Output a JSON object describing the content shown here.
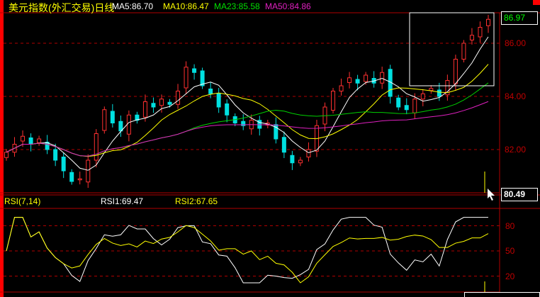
{
  "header": {
    "title": "美元指数(外汇交易)日线",
    "ma5": "MA5:86.70",
    "ma10": "MA10:86.47",
    "ma23": "MA23:85.58",
    "ma50": "MA50:84.86"
  },
  "price_axis": {
    "labels": [
      "86.00",
      "84.00",
      "82.00"
    ],
    "last_price": "86.97",
    "cursor_price": "80.49"
  },
  "rsi": {
    "title": "RSI(7,14)",
    "rsi1": "RSI1:69.47",
    "rsi2": "RSI2:67.65",
    "levels": [
      "80",
      "50",
      "20"
    ]
  },
  "colors": {
    "up": "#ff3030",
    "down": "#00e0e0",
    "ma5": "#ffffff",
    "ma10": "#ffff00",
    "ma23": "#00d000",
    "ma50": "#e020c0",
    "grid": "#b00000"
  },
  "chart_data": {
    "type": "candlestick",
    "closes": [
      81.9,
      82.2,
      82.5,
      82.2,
      82.4,
      82.0,
      81.6,
      81.2,
      80.8,
      80.9,
      81.6,
      82.6,
      83.5,
      83.0,
      82.7,
      83.3,
      83.1,
      83.8,
      83.6,
      83.9,
      83.7,
      84.2,
      85.1,
      84.9,
      84.4,
      84.1,
      83.6,
      83.3,
      83.0,
      82.9,
      83.1,
      82.8,
      83.0,
      82.4,
      81.9,
      81.5,
      81.6,
      82.0,
      82.9,
      83.6,
      84.2,
      84.4,
      84.7,
      84.5,
      84.8,
      84.5,
      84.9,
      84.0,
      83.6,
      83.5,
      83.9,
      84.1,
      84.3,
      84.0,
      84.6,
      85.4,
      86.0,
      86.3,
      86.6,
      86.9
    ],
    "ylim": [
      80.3,
      87.2
    ],
    "rsi_ylim": [
      0,
      100
    ]
  }
}
